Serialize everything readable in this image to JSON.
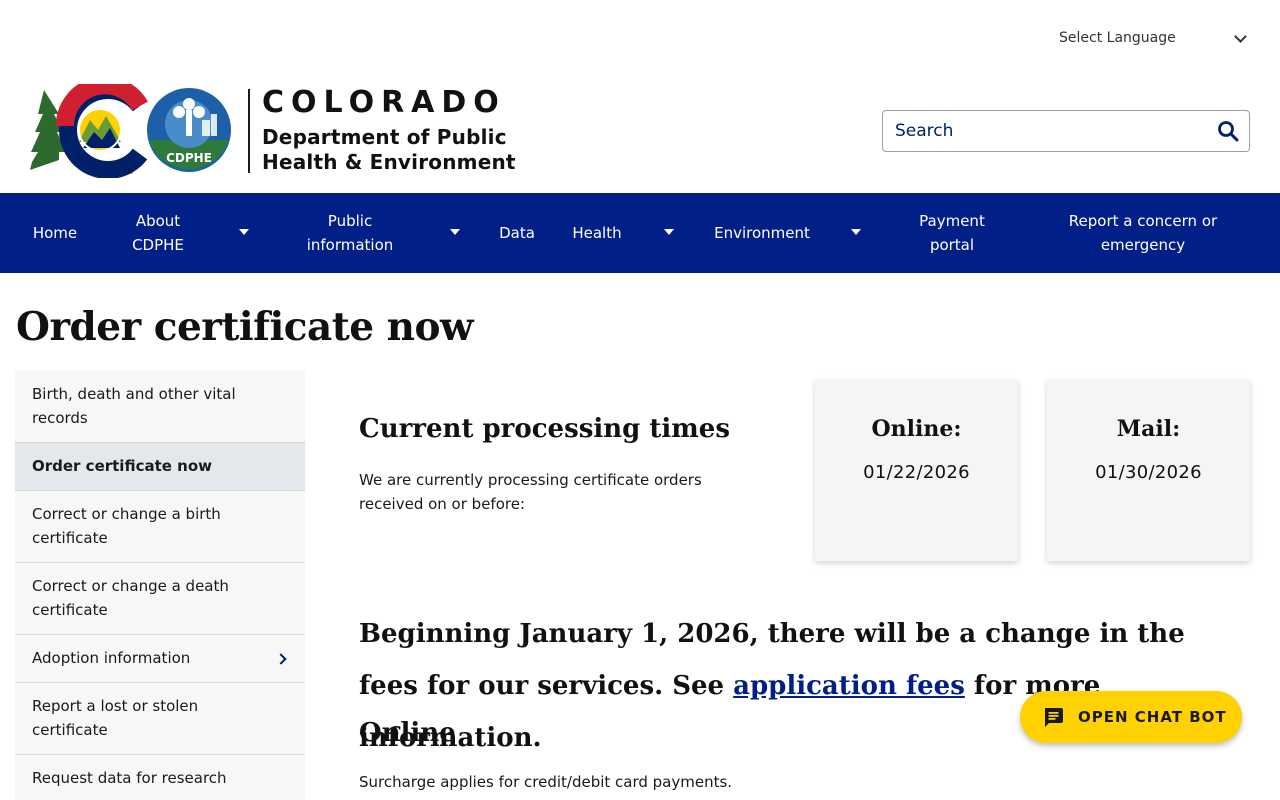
{
  "language": {
    "label": "Select Language"
  },
  "logo": {
    "state": "COLORADO",
    "dept_line1": "Department of Public",
    "dept_line2": "Health & Environment",
    "badge": "CDPHE"
  },
  "search": {
    "placeholder": "Search"
  },
  "nav": {
    "items": [
      {
        "label": "Home"
      },
      {
        "label": "About CDPHE"
      },
      {
        "label": "Public information"
      },
      {
        "label": "Data"
      },
      {
        "label": "Health"
      },
      {
        "label": "Environment"
      },
      {
        "label": "Payment portal"
      },
      {
        "label": "Report a concern or emergency"
      }
    ]
  },
  "page": {
    "title": "Order certificate now"
  },
  "sidenav": {
    "items": [
      {
        "label": "Birth, death and other vital records"
      },
      {
        "label": "Order certificate now"
      },
      {
        "label": "Correct or change a birth certificate"
      },
      {
        "label": "Correct or change a death certificate"
      },
      {
        "label": "Adoption information"
      },
      {
        "label": "Report a lost or stolen certificate"
      },
      {
        "label": "Request data for research"
      }
    ]
  },
  "processing": {
    "heading": "Current processing times",
    "description": "We are currently processing certificate orders received on or before:",
    "cards": [
      {
        "label": "Online:",
        "date": "01/22/2026"
      },
      {
        "label": "Mail:",
        "date": "01/30/2026"
      }
    ]
  },
  "announcement": {
    "before": "Beginning January 1, 2026, there will be a change in the fees for our services. See ",
    "link": "application fees",
    "after": " for more information."
  },
  "online": {
    "heading": "Online",
    "surcharge": "Surcharge applies for credit/debit card payments."
  },
  "chat": {
    "label": "OPEN CHAT BOT"
  },
  "colors": {
    "nav_bg": "#002088",
    "chat_bg": "#ffd100",
    "link": "#002088"
  }
}
